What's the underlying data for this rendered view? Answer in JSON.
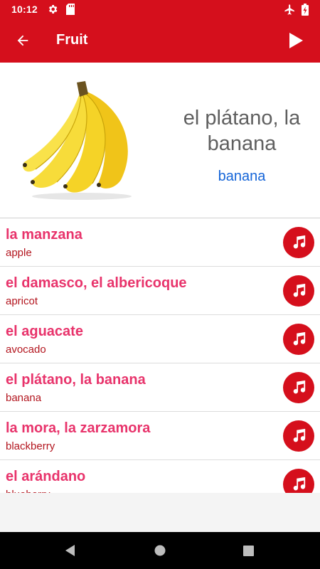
{
  "status_bar": {
    "time": "10:12",
    "icons": [
      "gear-icon",
      "sd-card-icon",
      "airplane-icon",
      "battery-charging-icon"
    ]
  },
  "app_bar": {
    "title": "Fruit",
    "back_icon": "arrow-left-icon",
    "play_icon": "play-icon"
  },
  "hero": {
    "image": "banana-image",
    "word": "el plátano, la banana",
    "translation": "banana"
  },
  "words": [
    {
      "word": "la manzana",
      "translation": "apple"
    },
    {
      "word": "el damasco, el albericoque",
      "translation": "apricot"
    },
    {
      "word": "el aguacate",
      "translation": "avocado"
    },
    {
      "word": "el plátano, la banana",
      "translation": "banana"
    },
    {
      "word": "la mora, la zarzamora",
      "translation": "blackberry"
    },
    {
      "word": "el arándano",
      "translation": "blueberry"
    }
  ],
  "nav": {
    "back_icon": "nav-back-icon",
    "home_icon": "nav-home-icon",
    "recents_icon": "nav-recents-icon"
  },
  "colors": {
    "primary": "#d50f1c",
    "word": "#e8336b",
    "translation": "#b3161f",
    "hero_word": "#5f5f5f",
    "hero_translation": "#1565d8"
  }
}
